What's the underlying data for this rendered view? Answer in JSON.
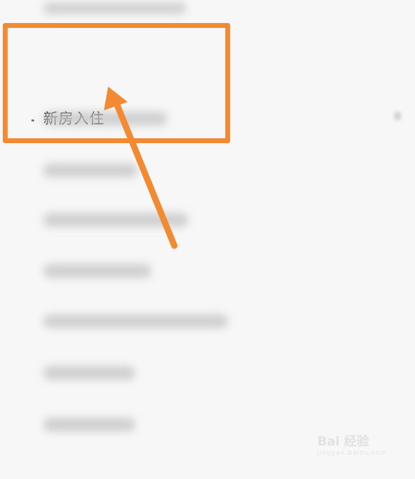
{
  "list": {
    "highlighted_item": {
      "label": "新房入住"
    },
    "blurred_items_count": 9
  },
  "annotation": {
    "box_color": "#f28a33",
    "arrow_color": "#f28a33"
  },
  "watermark": {
    "brand": "Bai 经验",
    "url": "jingyan.baidu.com"
  }
}
